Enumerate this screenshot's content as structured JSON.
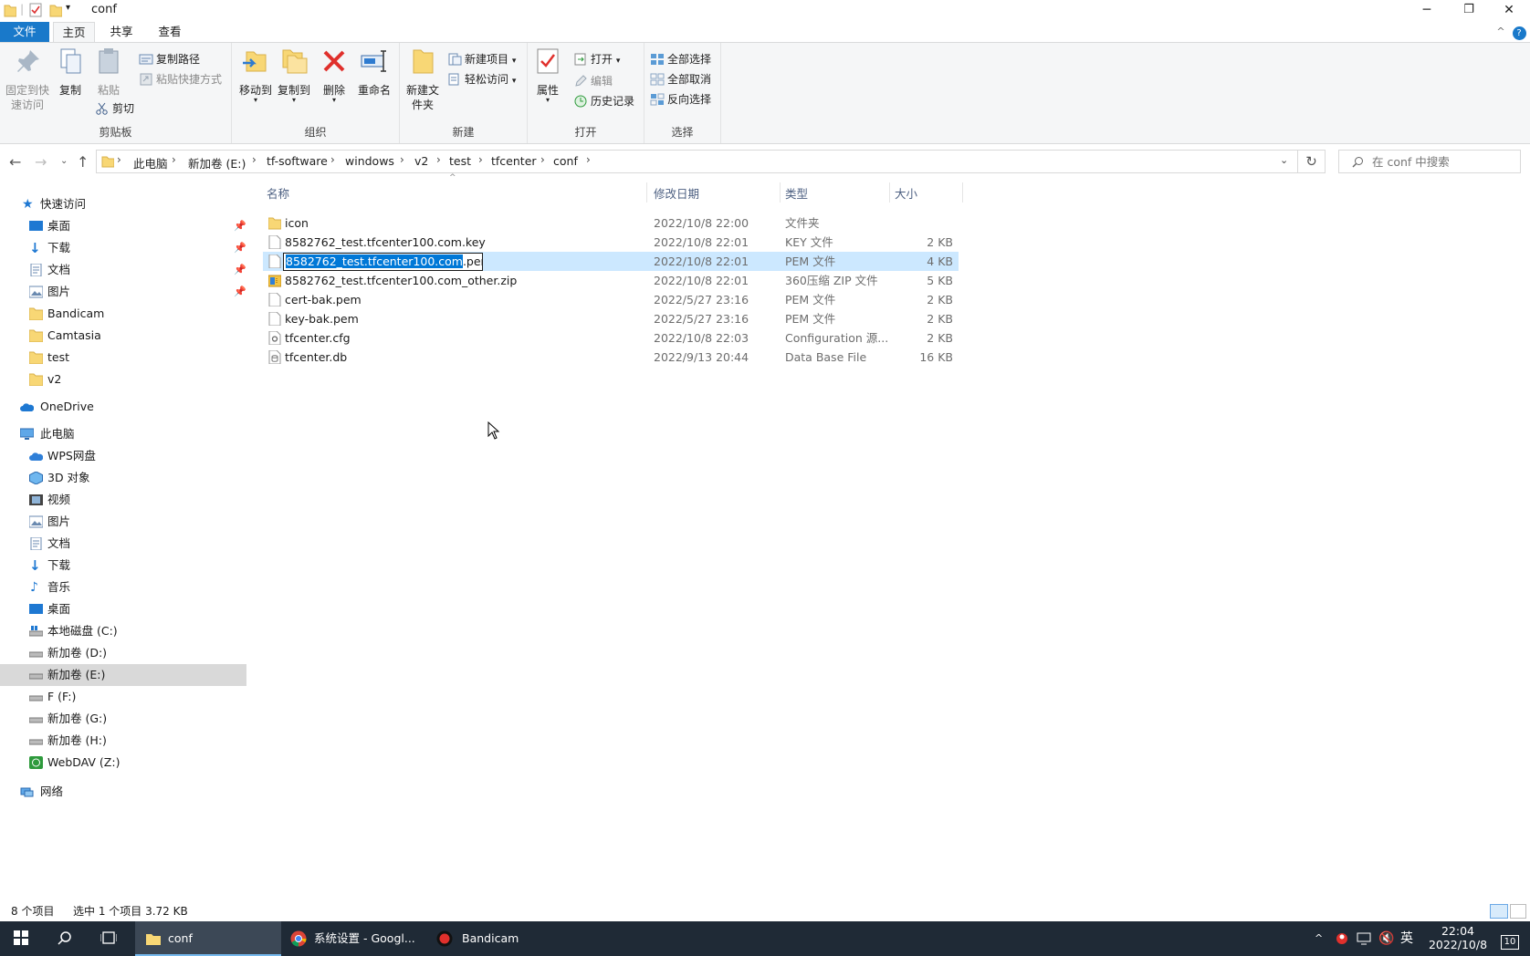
{
  "window": {
    "title": "conf",
    "minimize": "─",
    "restore": "❐",
    "close": "✕",
    "help": "?",
    "collapse": "^"
  },
  "tabs": {
    "file": "文件",
    "home": "主页",
    "share": "共享",
    "view": "查看"
  },
  "ribbon": {
    "clipboard": {
      "label": "剪贴板",
      "pin": "固定到快速访问",
      "copy": "复制",
      "paste": "粘贴",
      "copy_path": "复制路径",
      "paste_shortcut": "粘贴快捷方式",
      "cut": "剪切"
    },
    "organize": {
      "label": "组织",
      "move_to": "移动到",
      "copy_to": "复制到",
      "delete": "删除",
      "rename": "重命名"
    },
    "new": {
      "label": "新建",
      "new_folder": "新建文件夹",
      "new_item": "新建项目",
      "easy_access": "轻松访问"
    },
    "open": {
      "label": "打开",
      "properties": "属性",
      "open": "打开",
      "edit": "编辑",
      "history": "历史记录"
    },
    "select": {
      "label": "选择",
      "select_all": "全部选择",
      "select_none": "全部取消",
      "invert": "反向选择"
    }
  },
  "address": {
    "crumbs": [
      "此电脑",
      "新加卷 (E:)",
      "tf-software",
      "windows",
      "v2",
      "test",
      "tfcenter",
      "conf"
    ],
    "search_placeholder": "在 conf 中搜索"
  },
  "nav": {
    "quick_access": "快速访问",
    "desktop": "桌面",
    "downloads": "下载",
    "documents": "文档",
    "pictures": "图片",
    "bandicam": "Bandicam",
    "camtasia": "Camtasia",
    "test": "test",
    "v2": "v2",
    "onedrive": "OneDrive",
    "this_pc": "此电脑",
    "wps": "WPS网盘",
    "objects3d": "3D 对象",
    "videos": "视频",
    "pictures2": "图片",
    "documents2": "文档",
    "downloads2": "下载",
    "music": "音乐",
    "desktop2": "桌面",
    "drive_c": "本地磁盘 (C:)",
    "drive_d": "新加卷 (D:)",
    "drive_e": "新加卷 (E:)",
    "drive_f": "F (F:)",
    "drive_g": "新加卷 (G:)",
    "drive_h": "新加卷 (H:)",
    "drive_z": "WebDAV (Z:)",
    "network": "网络"
  },
  "columns": {
    "name": "名称",
    "date": "修改日期",
    "type": "类型",
    "size": "大小"
  },
  "files": [
    {
      "name": "icon",
      "date": "2022/10/8 22:00",
      "type": "文件夹",
      "size": "",
      "icon": "folder-icon"
    },
    {
      "name": "8582762_test.tfcenter100.com.key",
      "date": "2022/10/8 22:01",
      "type": "KEY 文件",
      "size": "2 KB",
      "icon": "file-icon"
    },
    {
      "name": "8582762_test.tfcenter100.com.pem",
      "date": "2022/10/8 22:01",
      "type": "PEM 文件",
      "size": "4 KB",
      "icon": "file-icon"
    },
    {
      "name": "8582762_test.tfcenter100.com_other.zip",
      "date": "2022/10/8 22:01",
      "type": "360压缩 ZIP 文件",
      "size": "5 KB",
      "icon": "zip-icon"
    },
    {
      "name": "cert-bak.pem",
      "date": "2022/5/27 23:16",
      "type": "PEM 文件",
      "size": "2 KB",
      "icon": "file-icon"
    },
    {
      "name": "key-bak.pem",
      "date": "2022/5/27 23:16",
      "type": "PEM 文件",
      "size": "2 KB",
      "icon": "file-icon"
    },
    {
      "name": "tfcenter.cfg",
      "date": "2022/10/8 22:03",
      "type": "Configuration 源...",
      "size": "2 KB",
      "icon": "config-file-icon"
    },
    {
      "name": "tfcenter.db",
      "date": "2022/9/13 20:44",
      "type": "Data Base File",
      "size": "16 KB",
      "icon": "database-file-icon"
    }
  ],
  "rename": {
    "selected_part": "8582762_test.tfcenter100.com",
    "extension": ".pem"
  },
  "status": {
    "count": "8 个项目",
    "selection": "选中 1 个项目  3.72 KB"
  },
  "taskbar": {
    "explorer": "conf",
    "chrome": "系统设置 - Googl...",
    "bandicam": "Bandicam",
    "ime": "英",
    "time": "22:04",
    "date": "2022/10/8",
    "notifications": "10"
  },
  "colors": {
    "accent": "#1979ca",
    "selection": "#cce8ff",
    "taskbar": "#1f2a36"
  }
}
